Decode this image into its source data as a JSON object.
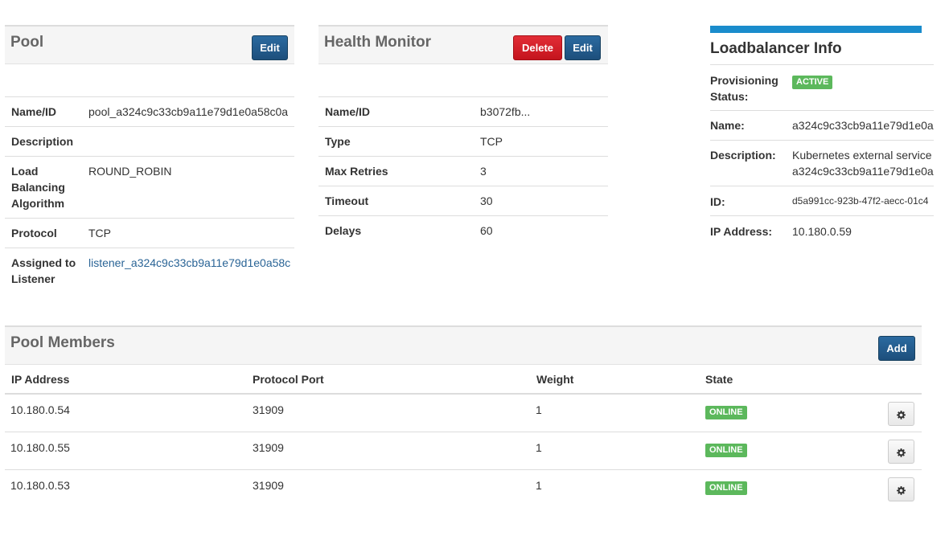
{
  "pool": {
    "title": "Pool",
    "edit_label": "Edit",
    "fields": [
      {
        "label": "Name/ID",
        "value": "pool_a324c9c33cb9a11e79d1e0a58c0a"
      },
      {
        "label": "Description",
        "value": ""
      },
      {
        "label": "Load Balancing Algorithm",
        "value": "ROUND_ROBIN"
      },
      {
        "label": "Protocol",
        "value": "TCP"
      },
      {
        "label": "Assigned to Listener",
        "value": "listener_a324c9c33cb9a11e79d1e0a58c"
      }
    ]
  },
  "health_monitor": {
    "title": "Health Monitor",
    "delete_label": "Delete",
    "edit_label": "Edit",
    "fields": [
      {
        "label": "Name/ID",
        "value": "b3072fb..."
      },
      {
        "label": "Type",
        "value": "TCP"
      },
      {
        "label": "Max Retries",
        "value": "3"
      },
      {
        "label": "Timeout",
        "value": "30"
      },
      {
        "label": "Delays",
        "value": "60"
      }
    ]
  },
  "lb_info": {
    "title": "Loadbalancer Info",
    "accent_color": "#1a8ccc",
    "fields": [
      {
        "label": "Provisioning Status:",
        "value": "ACTIVE"
      },
      {
        "label": "Name:",
        "value": "a324c9c33cb9a11e79d1e0a"
      },
      {
        "label": "Description:",
        "value": "Kubernetes external service",
        "value2": "a324c9c33cb9a11e79d1e0a"
      },
      {
        "label": "ID:",
        "value": "d5a991cc-923b-47f2-aecc-01c4"
      },
      {
        "label": "IP Address:",
        "value": "10.180.0.59"
      }
    ]
  },
  "pool_members": {
    "title": "Pool Members",
    "add_label": "Add",
    "columns": [
      "IP Address",
      "Protocol Port",
      "Weight",
      "State"
    ],
    "rows": [
      {
        "ip": "10.180.0.54",
        "port": "31909",
        "weight": "1",
        "state": "ONLINE"
      },
      {
        "ip": "10.180.0.55",
        "port": "31909",
        "weight": "1",
        "state": "ONLINE"
      },
      {
        "ip": "10.180.0.53",
        "port": "31909",
        "weight": "1",
        "state": "ONLINE"
      }
    ]
  },
  "colors": {
    "primary": "#1d4f7c",
    "danger": "#d9232c",
    "success": "#5cb85c",
    "link": "#2a6496"
  },
  "icons": {
    "row_action": "gear-icon"
  }
}
